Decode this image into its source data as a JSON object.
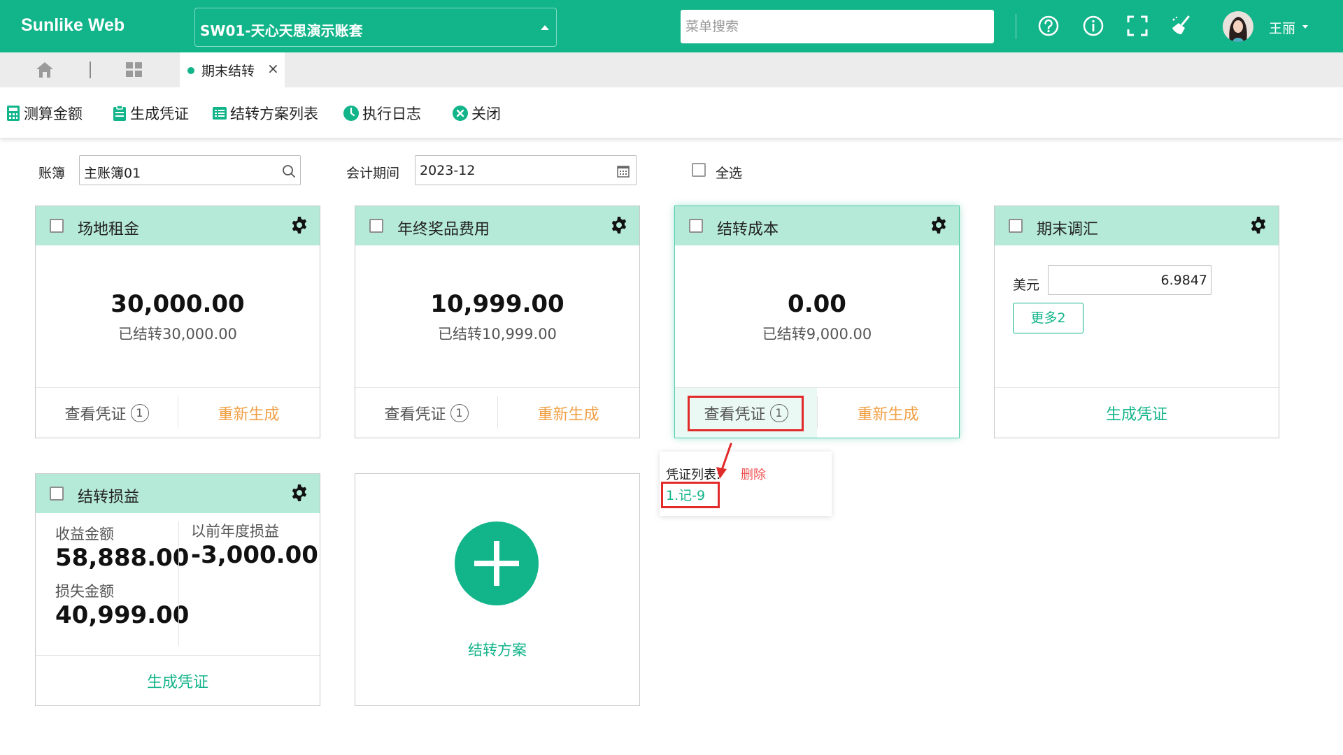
{
  "app": {
    "brand": "Sunlike Web",
    "account_set": "SW01-天心天思演示账套",
    "menu_search_placeholder": "菜单搜索",
    "user_name": "王丽",
    "top_icons": [
      "help-icon",
      "info-icon",
      "fullscreen-icon",
      "clean-icon"
    ]
  },
  "tabs": {
    "home_icon": "home-icon",
    "apps_icon": "grid-icon",
    "active_tab": "期末结转",
    "close_symbol": "×"
  },
  "toolbar": {
    "estimate": "测算金额",
    "generate_voucher": "生成凭证",
    "scheme_list": "结转方案列表",
    "exec_log": "执行日志",
    "close": "关闭"
  },
  "filters": {
    "ledger_label": "账簿",
    "ledger_value": "主账簿01",
    "period_label": "会计期间",
    "period_value": "2023-12",
    "select_all": "全选"
  },
  "cards": {
    "rent": {
      "title": "场地租金",
      "amount": "30,000.00",
      "carried": "已结转30,000.00",
      "view_voucher": "查看凭证",
      "voucher_count": "1",
      "regenerate": "重新生成"
    },
    "bonus": {
      "title": "年终奖品费用",
      "amount": "10,999.00",
      "carried": "已结转10,999.00",
      "view_voucher": "查看凭证",
      "voucher_count": "1",
      "regenerate": "重新生成"
    },
    "cost": {
      "title": "结转成本",
      "amount": "0.00",
      "carried": "已结转9,000.00",
      "view_voucher": "查看凭证",
      "voucher_count": "1",
      "regenerate": "重新生成"
    },
    "fx": {
      "title": "期末调汇",
      "currency_label": "美元",
      "rate": "6.9847",
      "more": "更多2",
      "generate": "生成凭证"
    },
    "pl": {
      "title": "结转损益",
      "income_label": "收益金额",
      "income_amount": "58,888.00",
      "loss_label": "损失金额",
      "loss_amount": "40,999.00",
      "prior_label": "以前年度损益",
      "prior_amount": "-3,000.00",
      "generate": "生成凭证"
    },
    "add": {
      "label": "结转方案"
    }
  },
  "popup": {
    "list_label": "凭证列表:",
    "delete": "删除",
    "voucher_link": "1.记-9"
  },
  "colors": {
    "brand": "#12b48a",
    "card_header": "#b5e9d8",
    "regenerate": "#f0a046",
    "highlight": "#e12a2a",
    "delete": "#ef5050"
  }
}
